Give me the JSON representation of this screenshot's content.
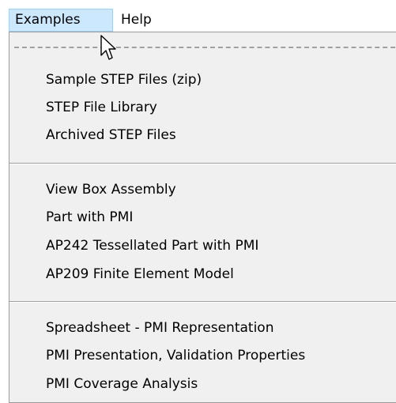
{
  "menubar": {
    "examples_label": "Examples",
    "help_label": "Help"
  },
  "menu": {
    "items": [
      {
        "label": "Sample STEP Files (zip)"
      },
      {
        "label": "STEP File Library"
      },
      {
        "label": "Archived STEP Files"
      },
      {
        "label": "View Box Assembly"
      },
      {
        "label": "Part with PMI"
      },
      {
        "label": "AP242 Tessellated Part with PMI"
      },
      {
        "label": "AP209 Finite Element Model"
      },
      {
        "label": "Spreadsheet - PMI Representation"
      },
      {
        "label": "PMI Presentation, Validation Properties"
      },
      {
        "label": "PMI Coverage Analysis"
      }
    ]
  },
  "colors": {
    "menubar_highlight": "#cce8ff",
    "menu_background": "#f0f0f0"
  }
}
